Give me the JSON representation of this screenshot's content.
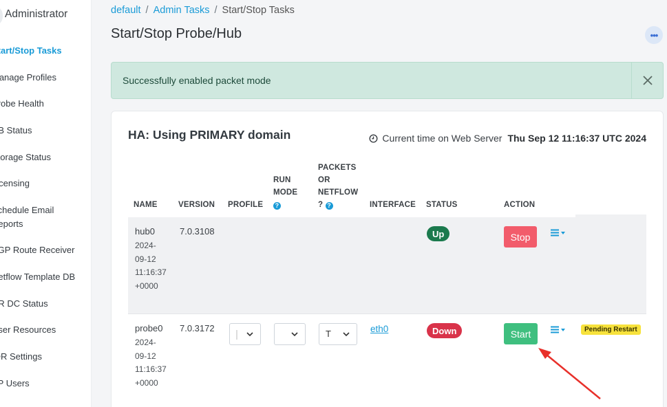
{
  "sidebar": {
    "title": "Administrator",
    "items": [
      {
        "label": "Start/Stop Tasks",
        "active": true
      },
      {
        "label": "Manage Profiles"
      },
      {
        "label": "Probe Health"
      },
      {
        "label": "DB Status"
      },
      {
        "label": "Storage Status"
      },
      {
        "label": "Licensing"
      },
      {
        "label": "Schedule Email"
      },
      {
        "label": "Reports"
      },
      {
        "label": "BGP Route Receiver"
      },
      {
        "label": "Netflow Template DB"
      },
      {
        "label": "DR DC Status"
      },
      {
        "label": "User Resources"
      },
      {
        "label": "IDR Settings"
      },
      {
        "label": "AP Users"
      }
    ]
  },
  "breadcrumb": {
    "items": [
      "default",
      "Admin Tasks",
      "Start/Stop Tasks"
    ],
    "separator": "/"
  },
  "page": {
    "title": "Start/Stop Probe/Hub"
  },
  "alert": {
    "message": "Successfully enabled packet mode"
  },
  "card": {
    "title": "HA: Using PRIMARY domain",
    "time_label": "Current time on Web Server",
    "time_value": "Thu Sep 12 11:16:37 UTC 2024"
  },
  "table": {
    "headers": {
      "name": "NAME",
      "version": "VERSION",
      "profile": "PROFILE",
      "run_mode_1": "RUN",
      "run_mode_2": "MODE",
      "packets_1": "PACKETS",
      "packets_2": "OR",
      "packets_3": "NETFLOW",
      "packets_4": "?",
      "interface": "INTERFACE",
      "status": "STATUS",
      "action": "ACTION"
    },
    "rows": [
      {
        "name": "hub0",
        "ts": [
          "2024-",
          "09-12",
          "11:16:37",
          "+0000"
        ],
        "version": "7.0.3108",
        "status": "Up",
        "action": "Stop"
      },
      {
        "name": "probe0",
        "ts": [
          "2024-",
          "09-12",
          "11:16:37",
          "+0000"
        ],
        "version": "7.0.3172",
        "packets_value": "T",
        "interface": "eth0",
        "status": "Down",
        "action": "Start",
        "pending": "Pending Restart"
      }
    ]
  },
  "colors": {
    "accent": "#1a9bd7",
    "up": "#1b7a4d",
    "down": "#d9334a",
    "stop": "#f25c6b",
    "start": "#3fbf7f",
    "alert_bg": "#cfe8df",
    "annotation_arrow": "#e8302a"
  },
  "icons": {
    "alert_close": "close-icon",
    "time": "clock-icon",
    "more": "ellipsis-icon",
    "row_menu": "list-menu-icon",
    "help": "question-icon"
  }
}
